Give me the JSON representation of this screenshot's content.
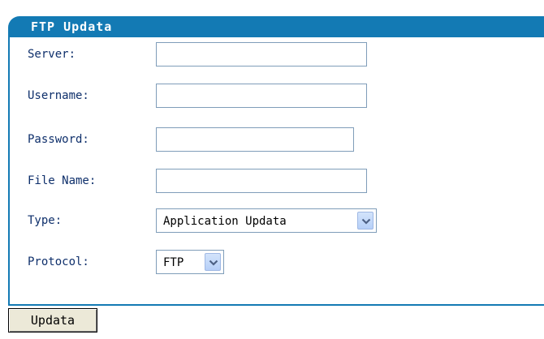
{
  "panel": {
    "title": "FTP Updata"
  },
  "fields": {
    "server": {
      "label": "Server:",
      "value": ""
    },
    "username": {
      "label": "Username:",
      "value": ""
    },
    "password": {
      "label": "Password:",
      "value": ""
    },
    "file_name": {
      "label": "File Name:",
      "value": ""
    }
  },
  "type": {
    "label": "Type:",
    "selected": "Application Updata"
  },
  "protocol": {
    "label": "Protocol:",
    "selected": "FTP"
  },
  "submit_label": "Updata",
  "colors": {
    "accent": "#137ab4",
    "label_text": "#0e2f6b"
  }
}
